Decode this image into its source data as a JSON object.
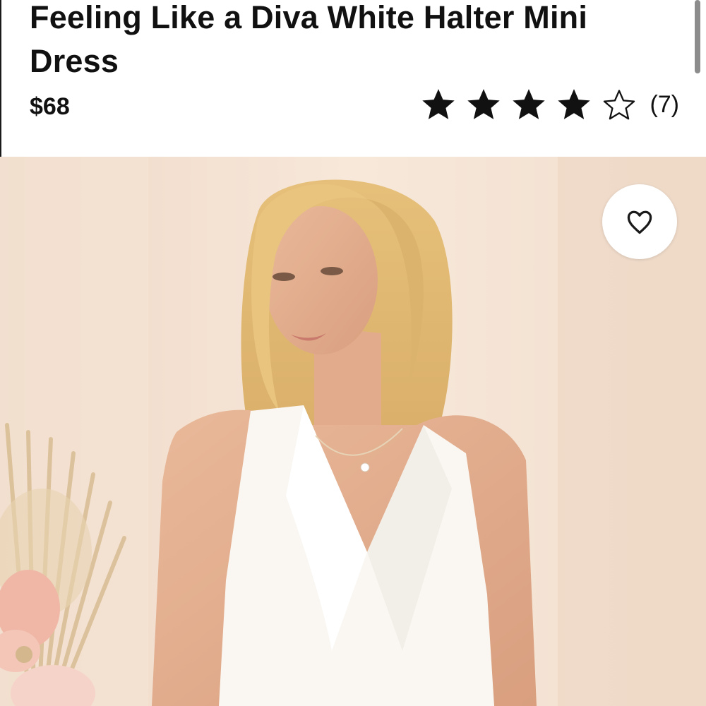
{
  "product": {
    "title": "Feeling Like a Diva White Halter Mini Dress",
    "price": "$68",
    "rating": {
      "value": 4,
      "max": 5,
      "count_label": "(7)"
    }
  },
  "icons": {
    "favorite": "heart-icon",
    "star_filled": "star-filled-icon",
    "star_empty": "star-outline-icon"
  },
  "colors": {
    "text": "#111111",
    "background": "#ffffff"
  }
}
